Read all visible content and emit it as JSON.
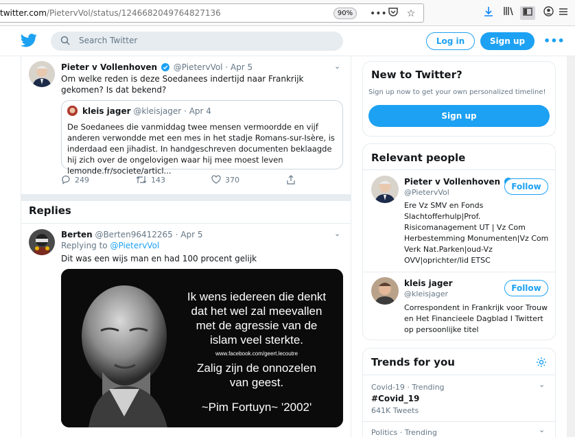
{
  "browser": {
    "url_prefix": "twitter.com",
    "url_path": "/PietervVol/status/1246682049764827136",
    "zoom": "90%"
  },
  "header": {
    "search_placeholder": "Search Twitter",
    "login_label": "Log in",
    "signup_label": "Sign up"
  },
  "main_tweet": {
    "name": "Pieter v Vollenhoven",
    "handle": "@PietervVol",
    "date": "Apr 5",
    "text": "Om welke reden is deze Soedanees indertijd naar Frankrijk gekomen? Is dat bekend?",
    "quote": {
      "name": "kleis jager",
      "handle": "@kleisjager",
      "date": "Apr 4",
      "text": "De Soedanees die vanmiddag twee mensen vermoordde en vijf anderen verwondde met een mes in het stadje Romans-sur-Isère, is inderdaad een jihadist. In handgeschreven documenten beklaagde hij zich over de ongelovigen waar hij mee moest leven lemonde.fr/societe/articl..."
    },
    "replies": "249",
    "retweets": "143",
    "likes": "370"
  },
  "replies_section": {
    "title": "Replies",
    "reply": {
      "name": "Berten",
      "handle": "@Berten96412265",
      "date": "Apr 5",
      "replying_to_label": "Replying to",
      "replying_to": "@PietervVol",
      "text": "Dit was een wijs man en had 100 procent gelijk",
      "image_text": {
        "line1": "Ik wens iedereen die denkt",
        "line2": "dat het wel zal meevallen",
        "line3": "met de agressie van de",
        "line4": "islam veel sterkte.",
        "fb": "www.facebook.com/geert.lecoutre",
        "line5": "Zalig zijn de onnozelen",
        "line6": "van geest.",
        "line7": "~Pim Fortuyn~ '2002'"
      }
    }
  },
  "sidebar": {
    "new_to_twitter": {
      "title": "New to Twitter?",
      "subtitle": "Sign up now to get your own personalized timeline!",
      "signup_label": "Sign up"
    },
    "relevant_people": {
      "title": "Relevant people",
      "follow_label": "Follow",
      "people": [
        {
          "name": "Pieter v Vollenhoven",
          "handle": "@PietervVol",
          "bio": "Ere Vz SMV en Fonds Slachtofferhulp|Prof. Risicomanagement UT | Vz Com Herbestemming Monumenten|Vz Com Verk Nat.Parken|oud-Vz OVV|oprichter/lid ETSC"
        },
        {
          "name": "kleis jager",
          "handle": "@kleisjager",
          "bio": "Correspondent in Frankrijk voor Trouw en Het Financieele Dagblad I Twittert op persoonlijke titel"
        }
      ]
    },
    "trends": {
      "title": "Trends for you",
      "items": [
        {
          "meta": "Covid-19 · Trending",
          "name": "#Covid_19",
          "count": "641K Tweets"
        },
        {
          "meta": "Politics · Trending"
        }
      ]
    }
  },
  "colors": {
    "twitter_blue": "#1da1f2",
    "text_primary": "#14171a",
    "text_secondary": "#657786",
    "border": "#e6ecf0"
  }
}
